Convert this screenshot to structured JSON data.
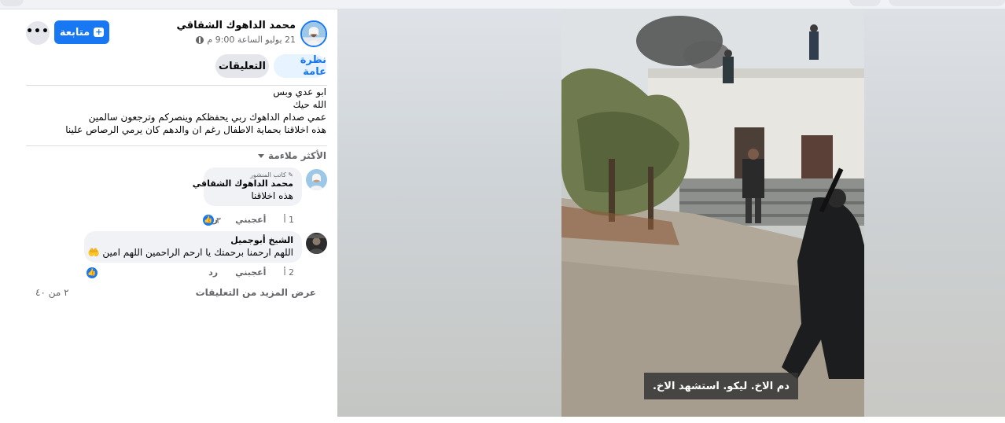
{
  "post": {
    "author": "محمد الداهوك الشقاقي",
    "timestamp": "21 يوليو الساعة 9:00 م",
    "privacy_icon": "globe-icon",
    "follow_label": "متابعة",
    "more_label": "•••",
    "tabs": [
      "نظرة عامة",
      "التعليقات"
    ],
    "text_lines": [
      "ابو عدي وبس",
      "الله حيك",
      "عمي صدام الداهوك ربي يحفظكم وينصركم وترجعون سالمين",
      "هذه اخلاقنا بحماية الاطفال رغم ان والدهم كان يرمي الرصاص علينا"
    ]
  },
  "comments_section": {
    "sort_label": "الأكثر ملاءمة",
    "comments": [
      {
        "badge": "كاتب المنشور",
        "author": "محمد الداهوك الشقاقي",
        "text": "هذه اخلاقنا",
        "age": "1 أ",
        "like_label": "أعجبني",
        "reply_label": "رد",
        "reactions": "٣"
      },
      {
        "author": "الشيخ أبوجميل",
        "text": "اللهم ارحمنا برحمتك يا ارحم الراحمين اللهم امين 🤲",
        "age": "2 أ",
        "like_label": "أعجبني",
        "reply_label": "رد",
        "reactions": ""
      }
    ],
    "view_more_label": "عرض المزيد من التعليقات",
    "count_label": "٢ من ٤٠"
  },
  "media": {
    "caption": "دم الاخ. ليكو. استشهد الاخ."
  },
  "colors": {
    "accent": "#1877f2",
    "secondary_text": "#65676b",
    "bubble": "#f0f2f5"
  }
}
